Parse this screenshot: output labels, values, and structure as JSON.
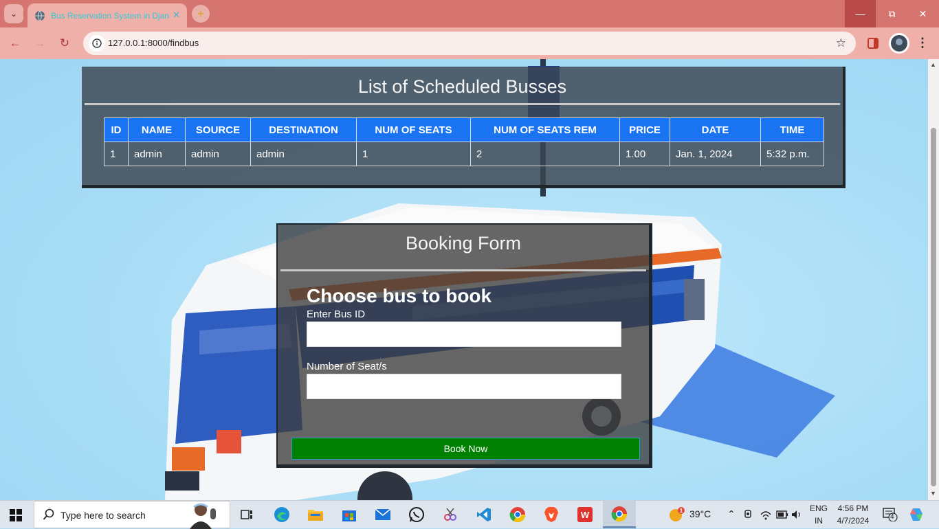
{
  "browser": {
    "tab_title": "Bus Reservation System in Djan",
    "url": "127.0.0.1:8000/findbus"
  },
  "bus_list": {
    "title": "List of Scheduled Busses",
    "columns": [
      "ID",
      "NAME",
      "SOURCE",
      "DESTINATION",
      "NUM OF SEATS",
      "NUM OF SEATS REM",
      "PRICE",
      "DATE",
      "TIME"
    ],
    "rows": [
      [
        "1",
        "admin",
        "admin",
        "admin",
        "1",
        "2",
        "1.00",
        "Jan. 1, 2024",
        "5:32 p.m."
      ]
    ]
  },
  "booking_form": {
    "title": "Booking Form",
    "heading": "Choose bus to book",
    "bus_id_label": "Enter Bus ID",
    "bus_id_value": "",
    "seats_label": "Number of Seat/s",
    "seats_value": "",
    "submit_label": "Book Now"
  },
  "taskbar": {
    "search_placeholder": "Type here to search",
    "temperature": "39°C",
    "lang_top": "ENG",
    "lang_bottom": "IN",
    "time": "4:56 PM",
    "date": "4/7/2024",
    "notification_count": "4",
    "apps": [
      "task-view",
      "edge",
      "file-explorer",
      "store",
      "mail",
      "whatsapp",
      "snip",
      "vscode",
      "chrome",
      "brave",
      "wps",
      "chrome-active"
    ]
  },
  "colors": {
    "table_header": "#1a73f0",
    "book_button": "#008000",
    "browser_frame": "#d6746f"
  }
}
